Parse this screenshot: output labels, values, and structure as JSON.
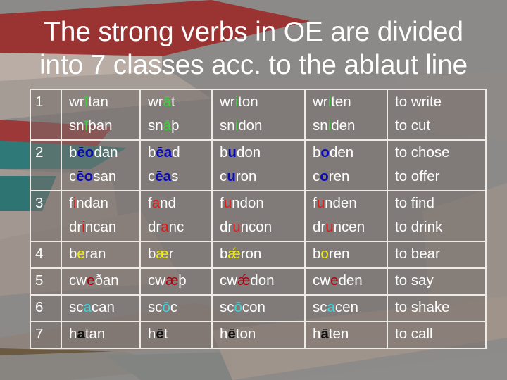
{
  "slide": {
    "title_lines": [
      "The strong verbs in OE are divided",
      "into 7 classes acc. to the ablaut line"
    ]
  },
  "colors": {
    "class1": "#33d633",
    "class2": "#0a0ab8",
    "class3": "#e01818",
    "class4": "#f0f000",
    "class5": "#b00010",
    "class6": "#3cd6dc",
    "class7": "#111111"
  },
  "table": {
    "rows": [
      {
        "class": "1",
        "color": "green",
        "cells": [
          [
            [
              "wr",
              "ī",
              "tan"
            ],
            [
              "sn",
              "ī",
              "þan"
            ]
          ],
          [
            [
              "wr",
              "ā",
              "t"
            ],
            [
              "sn",
              "ā",
              "þ"
            ]
          ],
          [
            [
              "wr",
              "i",
              "ton"
            ],
            [
              "sn",
              "i",
              "don"
            ]
          ],
          [
            [
              "wr",
              "i",
              "ten"
            ],
            [
              "sn",
              "i",
              "den"
            ]
          ]
        ],
        "meanings": [
          "to write",
          "to cut"
        ]
      },
      {
        "class": "2",
        "color": "blue",
        "cells": [
          [
            [
              "b",
              "ēo",
              "dan"
            ],
            [
              "c",
              "ēo",
              "san"
            ]
          ],
          [
            [
              "b",
              "ēa",
              "d"
            ],
            [
              "c",
              "ēa",
              "s"
            ]
          ],
          [
            [
              "b",
              "u",
              "don"
            ],
            [
              "c",
              "u",
              "ron"
            ]
          ],
          [
            [
              "b",
              "o",
              "den"
            ],
            [
              "c",
              "o",
              "ren"
            ]
          ]
        ],
        "meanings": [
          "to chose",
          "to offer"
        ]
      },
      {
        "class": "3",
        "color": "red",
        "cells": [
          [
            [
              "f",
              "i",
              "ndan"
            ],
            [
              "dr",
              "i",
              "ncan"
            ]
          ],
          [
            [
              "f",
              "a",
              "nd"
            ],
            [
              "dr",
              "a",
              "nc"
            ]
          ],
          [
            [
              "f",
              "u",
              "ndon"
            ],
            [
              "dr",
              "u",
              "ncon"
            ]
          ],
          [
            [
              "f",
              "u",
              "nden"
            ],
            [
              "dr",
              "u",
              "ncen"
            ]
          ]
        ],
        "meanings": [
          "to find",
          "to drink"
        ]
      },
      {
        "class": "4",
        "color": "yellow",
        "cells": [
          [
            [
              "b",
              "e",
              "ran"
            ]
          ],
          [
            [
              "b",
              "æ",
              "r"
            ]
          ],
          [
            [
              "b",
              "ǽ",
              "ron"
            ]
          ],
          [
            [
              "b",
              "o",
              "ren"
            ]
          ]
        ],
        "meanings": [
          "to bear"
        ]
      },
      {
        "class": "5",
        "color": "darkred",
        "cells": [
          [
            [
              "cw",
              "e",
              "ðan"
            ]
          ],
          [
            [
              "cw",
              "æ",
              "þ"
            ]
          ],
          [
            [
              "cw",
              "ǽ",
              "don"
            ]
          ],
          [
            [
              "cw",
              "e",
              "den"
            ]
          ]
        ],
        "meanings": [
          "to say"
        ]
      },
      {
        "class": "6",
        "color": "cyan",
        "cells": [
          [
            [
              "sc",
              "a",
              "can"
            ]
          ],
          [
            [
              "sc",
              "ō",
              "c"
            ]
          ],
          [
            [
              "sc",
              "ō",
              "con"
            ]
          ],
          [
            [
              "sc",
              "a",
              "cen"
            ]
          ]
        ],
        "meanings": [
          "to shake"
        ]
      },
      {
        "class": "7",
        "color": "black",
        "cells": [
          [
            [
              "h",
              "a",
              "tan"
            ]
          ],
          [
            [
              "h",
              "ē",
              "t"
            ]
          ],
          [
            [
              "h",
              "ē",
              "ton"
            ]
          ],
          [
            [
              "h",
              "ā",
              "ten"
            ]
          ]
        ],
        "meanings": [
          "to call"
        ]
      }
    ]
  }
}
